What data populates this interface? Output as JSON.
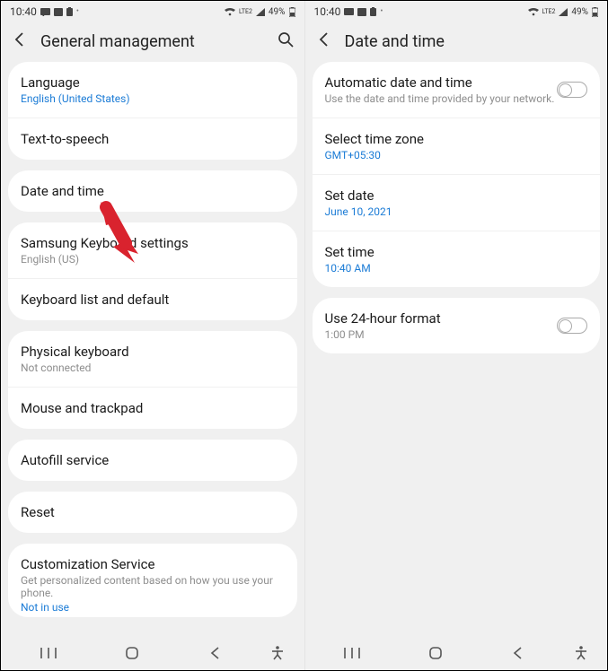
{
  "status": {
    "time": "10:40",
    "battery": "49%",
    "net_label": "LTE2"
  },
  "left": {
    "title": "General management",
    "groups": [
      [
        {
          "label": "Language",
          "sub": "English (United States)",
          "accent": true
        },
        {
          "label": "Text-to-speech"
        }
      ],
      [
        {
          "label": "Date and time"
        }
      ],
      [
        {
          "label": "Samsung Keyboard settings",
          "sub": "English (US)"
        },
        {
          "label": "Keyboard list and default"
        }
      ],
      [
        {
          "label": "Physical keyboard",
          "sub": "Not connected"
        },
        {
          "label": "Mouse and trackpad"
        }
      ],
      [
        {
          "label": "Autofill service"
        }
      ],
      [
        {
          "label": "Reset"
        }
      ],
      [
        {
          "label": "Customization Service",
          "sub": "Get personalized content based on how you use your phone.",
          "sub2": "Not in use"
        }
      ]
    ]
  },
  "right": {
    "title": "Date and time",
    "groups": [
      [
        {
          "label": "Automatic date and time",
          "sub": "Use the date and time provided by your network.",
          "toggle": true
        },
        {
          "label": "Select time zone",
          "sub": "GMT+05:30",
          "accent": true
        },
        {
          "label": "Set date",
          "sub": "June 10, 2021",
          "accent": true
        },
        {
          "label": "Set time",
          "sub": "10:40 AM",
          "accent": true
        }
      ],
      [
        {
          "label": "Use 24-hour format",
          "sub": "1:00 PM",
          "toggle": true
        }
      ]
    ]
  },
  "colors": {
    "accent": "#1c7cd6",
    "arrow": "#d9232e"
  }
}
